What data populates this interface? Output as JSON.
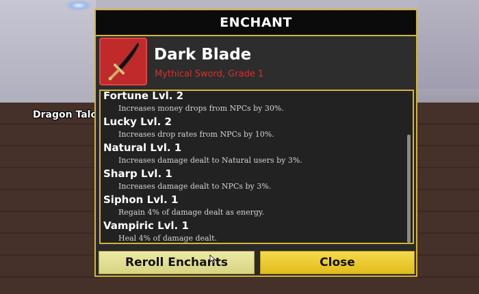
{
  "world": {
    "player_label": "Dragon Talo"
  },
  "enchant_window": {
    "title": "ENCHANT",
    "item": {
      "name": "Dark Blade",
      "subtitle": "Mythical Sword, Grade 1",
      "icon": "dark-blade-sword-icon",
      "icon_bg_color": "#c12a2a",
      "subtitle_color": "#d92f2f"
    },
    "enchants": [
      {
        "name": "Fortune Lvl. 2",
        "desc": "Increases money drops from NPCs by 30%."
      },
      {
        "name": "Lucky Lvl. 2",
        "desc": "Increases drop rates from NPCs by 10%."
      },
      {
        "name": "Natural Lvl. 1",
        "desc": "Increases damage dealt to Natural users by 3%."
      },
      {
        "name": "Sharp Lvl. 1",
        "desc": "Increases damage dealt to NPCs by 3%."
      },
      {
        "name": "Siphon Lvl. 1",
        "desc": "Regain 4% of damage dealt as energy."
      },
      {
        "name": "Vampiric Lvl. 1",
        "desc": "Heal 4% of damage dealt."
      }
    ],
    "buttons": {
      "reroll": "Reroll Enchants",
      "close": "Close"
    },
    "accent_color": "#d6b536"
  }
}
